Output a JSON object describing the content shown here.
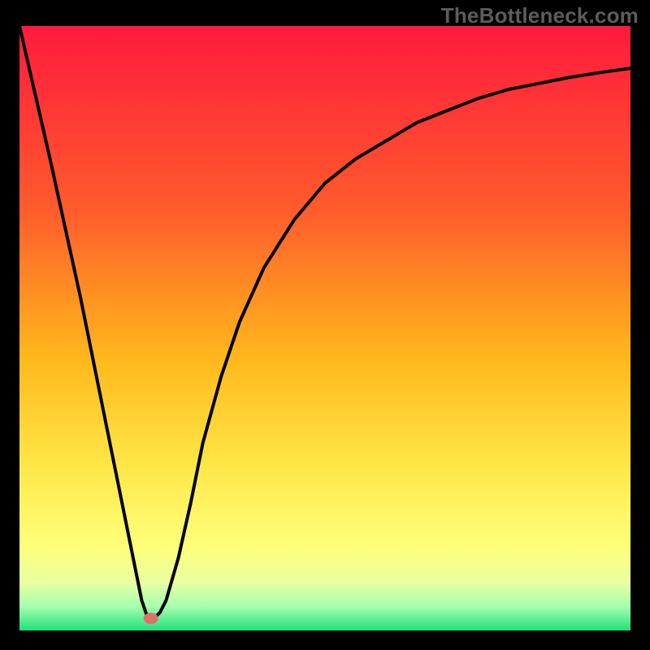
{
  "watermark": "TheBottleneck.com",
  "chart_data": {
    "type": "line",
    "title": "",
    "xlabel": "",
    "ylabel": "",
    "xlim": [
      0,
      100
    ],
    "ylim": [
      0,
      100
    ],
    "background_gradient_stops": [
      {
        "offset": 0.0,
        "color": "#ff1a3e"
      },
      {
        "offset": 0.3,
        "color": "#ff5a2c"
      },
      {
        "offset": 0.55,
        "color": "#ffb81c"
      },
      {
        "offset": 0.72,
        "color": "#ffe545"
      },
      {
        "offset": 0.86,
        "color": "#ffff7a"
      },
      {
        "offset": 0.92,
        "color": "#eaffa0"
      },
      {
        "offset": 0.96,
        "color": "#a5ffb0"
      },
      {
        "offset": 1.0,
        "color": "#20e07a"
      }
    ],
    "series": [
      {
        "name": "curve",
        "color": "#000000",
        "x": [
          0,
          5,
          10,
          14,
          17,
          19,
          20,
          21,
          22,
          23,
          24,
          26,
          28,
          30,
          33,
          36,
          40,
          45,
          50,
          55,
          60,
          65,
          70,
          75,
          80,
          85,
          90,
          95,
          100
        ],
        "y": [
          100,
          78,
          55,
          35,
          20,
          10,
          5,
          2,
          2,
          3,
          5,
          12,
          21,
          31,
          42,
          51,
          60,
          68,
          74,
          78,
          81,
          84,
          86,
          88,
          89.5,
          90.5,
          91.5,
          92.3,
          93
        ]
      }
    ],
    "marker": {
      "name": "highlight-point",
      "x": 21.5,
      "y": 2,
      "color": "#e0706c",
      "radius_px": 8
    }
  }
}
